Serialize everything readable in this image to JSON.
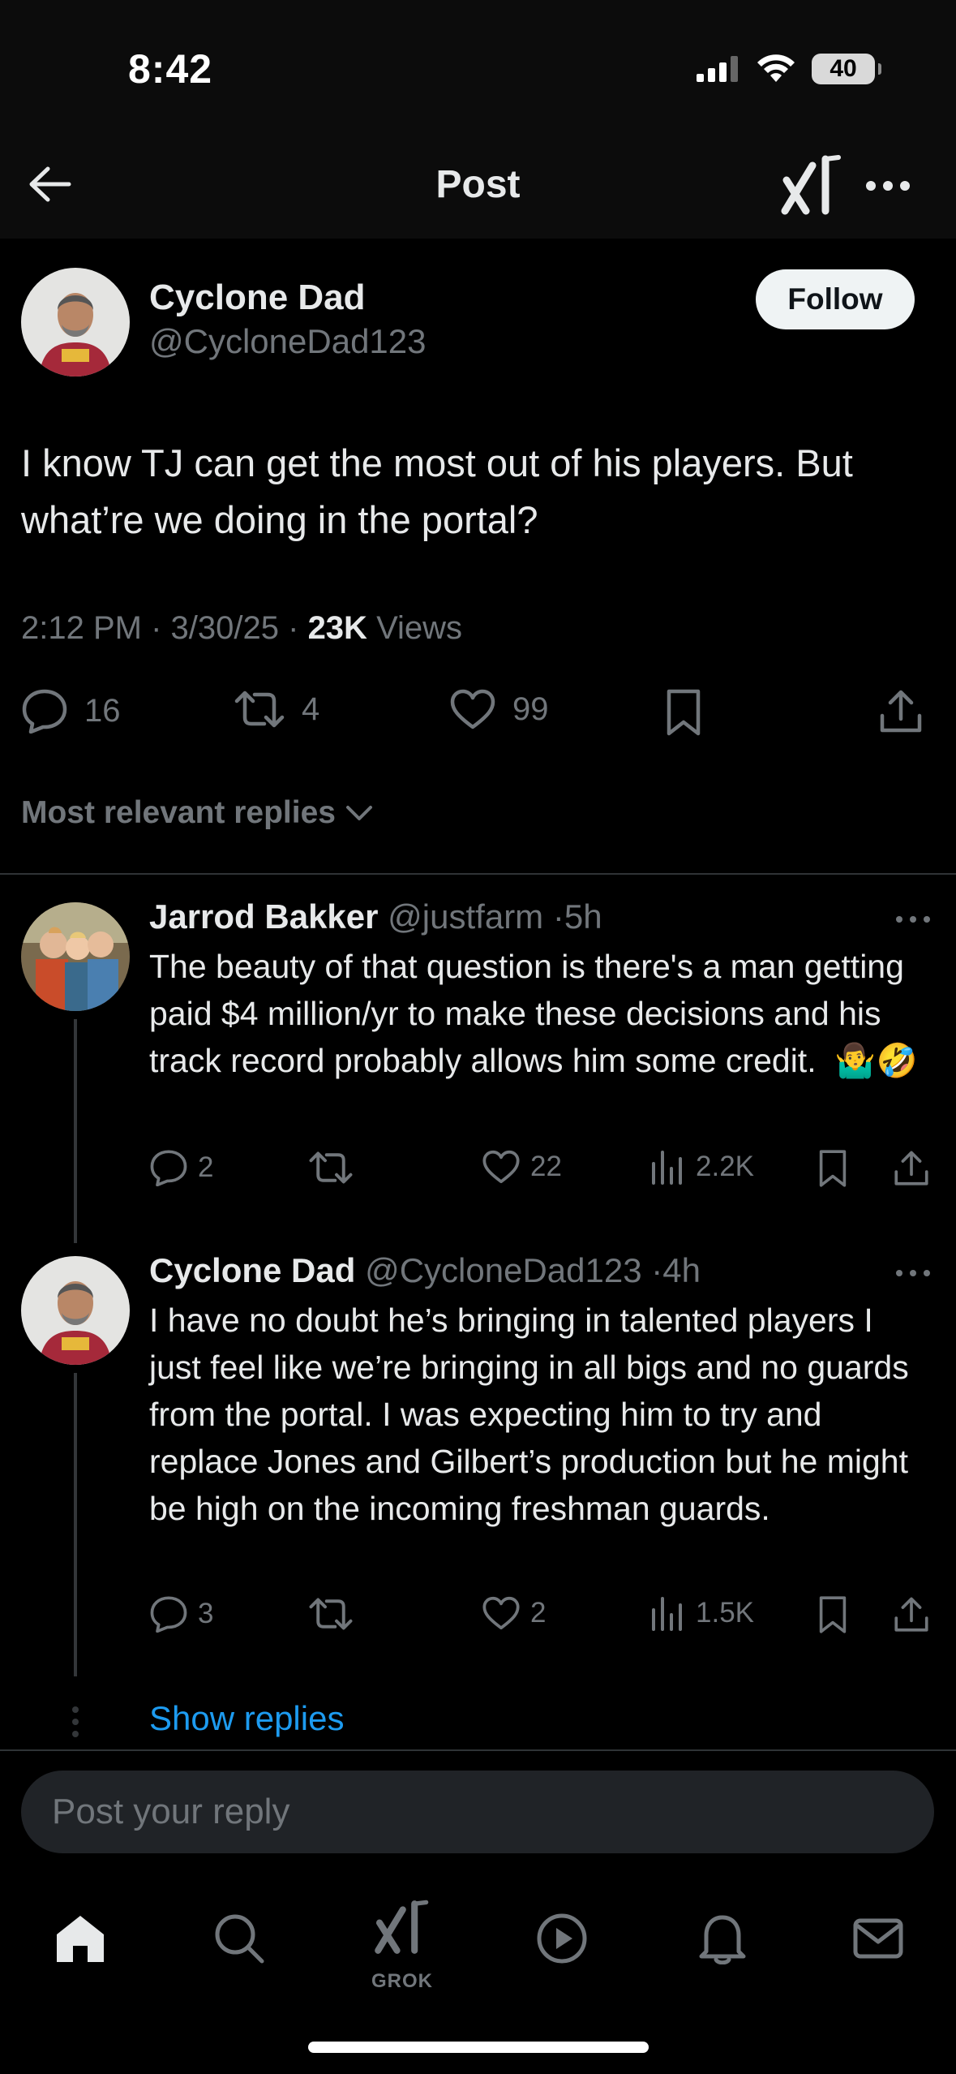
{
  "status_bar": {
    "time": "8:42",
    "battery": "40"
  },
  "header": {
    "title": "Post",
    "back_icon": "arrow-left-icon",
    "grok_icon": "grok-icon",
    "more_icon": "ellipsis-icon"
  },
  "post": {
    "author_name": "Cyclone Dad",
    "author_handle": "@CycloneDad123",
    "follow_label": "Follow",
    "text": "I know TJ can get the most out of his players. But what’re we doing in the portal?",
    "time": "2:12 PM",
    "date": "3/30/25",
    "views_count": "23K",
    "views_label": "Views",
    "replies": "16",
    "reposts": "4",
    "likes": "99"
  },
  "sort": {
    "label": "Most relevant replies"
  },
  "replies": [
    {
      "name": "Jarrod Bakker",
      "handle": "@justfarm",
      "age": "5h",
      "text": "The beauty of that question is there's a man getting paid $4 million/yr to make these decisions and his track record probably allows him some credit.",
      "emojis": "🤷‍♂️🤣",
      "replies": "2",
      "reposts": "",
      "likes": "22",
      "views": "2.2K"
    },
    {
      "name": "Cyclone Dad",
      "handle": "@CycloneDad123",
      "age": "4h",
      "text": "I have no doubt he’s bringing in talented players I just feel like we’re bringing in all bigs and no guards from the portal. I was expecting him to try and replace Jones and Gilbert’s production but he might be high on the incoming freshman guards.",
      "replies": "3",
      "reposts": "",
      "likes": "2",
      "views": "1.5K"
    }
  ],
  "show_replies": "Show replies",
  "composer": {
    "placeholder": "Post your reply"
  },
  "bottom_nav": {
    "grok_label": "GROK",
    "items": [
      "home-icon",
      "search-icon",
      "grok-icon",
      "play-icon",
      "bell-icon",
      "mail-icon"
    ]
  },
  "colors": {
    "background": "#000000",
    "accent": "#1d9bf0",
    "muted": "#71767b",
    "text": "#e7e9ea"
  }
}
